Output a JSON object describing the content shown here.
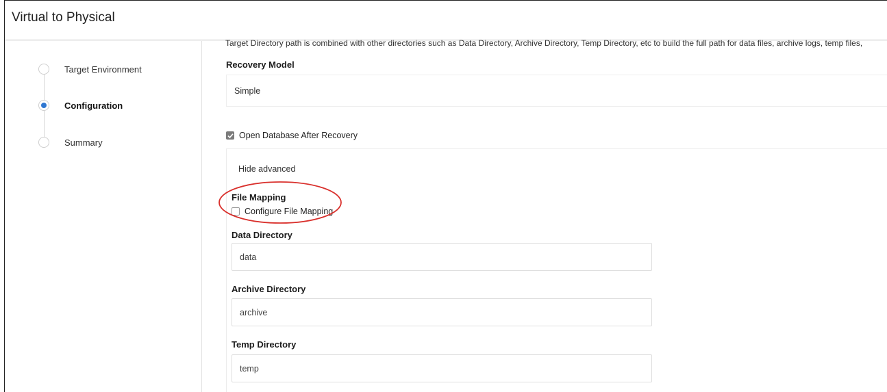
{
  "window": {
    "title": "Virtual to Physical"
  },
  "steps": [
    {
      "label": "Target Environment",
      "state": "inactive"
    },
    {
      "label": "Configuration",
      "state": "active"
    },
    {
      "label": "Summary",
      "state": "inactive"
    }
  ],
  "config": {
    "help_text": "Target Directory path is combined with other directories such as Data Directory, Archive Directory, Temp Directory, etc to build the full path for data files, archive logs, temp files,",
    "recovery_model_label": "Recovery Model",
    "recovery_model_value": "Simple",
    "open_db_label": "Open Database After Recovery",
    "open_db_checked": true,
    "hide_advanced": "Hide advanced",
    "file_mapping_label": "File Mapping",
    "configure_file_mapping_label": "Configure File Mapping",
    "configure_file_mapping_checked": false,
    "data_dir_label": "Data Directory",
    "data_dir_value": "data",
    "archive_dir_label": "Archive Directory",
    "archive_dir_value": "archive",
    "temp_dir_label": "Temp Directory",
    "temp_dir_value": "temp"
  },
  "colors": {
    "accent": "#2f77d1",
    "annotation": "#d9302c"
  }
}
